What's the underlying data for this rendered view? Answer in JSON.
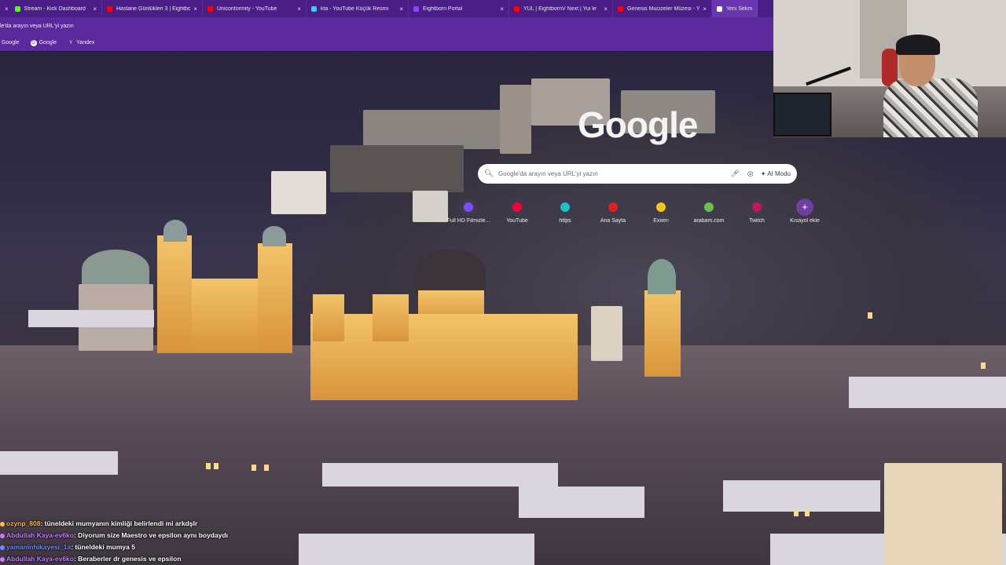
{
  "browser": {
    "tabs": [
      {
        "title": "Stream - Kick Dashboard",
        "favicon": "kick-icon",
        "favicon_color": "#53fc18",
        "active": false
      },
      {
        "title": "Hastane Günlükleri 3 | Eightbo",
        "favicon": "youtube-icon",
        "favicon_color": "#ff0000",
        "active": false
      },
      {
        "title": "Uniconformity - YouTube",
        "favicon": "youtube-icon",
        "favicon_color": "#ff0000",
        "active": false
      },
      {
        "title": "kta - YouTube Küçük Resmi",
        "favicon": "thumbnail-icon",
        "favicon_color": "#4fc3f7",
        "active": false
      },
      {
        "title": "Eightborn Portal",
        "favicon": "eightborn-icon",
        "favicon_color": "#8e44ff",
        "active": false
      },
      {
        "title": "YUL | EightbornV Next | Yui le",
        "favicon": "youtube-icon",
        "favicon_color": "#ff0000",
        "active": false
      },
      {
        "title": "Genesis Mucizeler Müzesi - Yo",
        "favicon": "youtube-icon",
        "favicon_color": "#ff0000",
        "active": false
      },
      {
        "title": "Yeni Sekme",
        "favicon": "chrome-icon",
        "favicon_color": "#ffffff",
        "active": true
      }
    ],
    "address_text": "le'da arayın veya URL'yi yazın",
    "bookmarks": [
      {
        "label": "Google",
        "icon": "google-icon"
      },
      {
        "label": "Google",
        "icon": "google-icon"
      },
      {
        "label": "Yandex",
        "icon": "yandex-icon"
      }
    ],
    "theme_color": "#5a2a9c"
  },
  "newtab": {
    "logo": "Google",
    "search_placeholder": "Google'da arayın veya URL'yi yazın",
    "ai_mode_label": "AI Modu",
    "shortcuts": [
      {
        "label": "Full HD Filmizle...",
        "icon": "film-icon",
        "color": "#7c4dff"
      },
      {
        "label": "YouTube",
        "icon": "youtube-icon",
        "color": "#ff0033"
      },
      {
        "label": "https",
        "icon": "link-icon",
        "color": "#18c4c9"
      },
      {
        "label": "Ana Sayfa",
        "icon": "home-icon",
        "color": "#e02020"
      },
      {
        "label": "Exxen",
        "icon": "exxen-icon",
        "color": "#f5c518"
      },
      {
        "label": "arabam.com",
        "icon": "arabam-icon",
        "color": "#6abf4b"
      },
      {
        "label": "Twitch",
        "icon": "twitch-icon",
        "color": "#c2185b"
      },
      {
        "label": "Kısayol ekle",
        "icon": "plus-icon",
        "color": "#9c27b0"
      }
    ]
  },
  "chat": {
    "messages": [
      {
        "user": "ozynp_808",
        "text": ": tüneldeki mumyanın kimliği belirlendi mi arkdşlr",
        "user_color": "#ffb84d"
      },
      {
        "user": "Abdullah Kaya-ev6ko",
        "text": ": Diyorum size Maestro ve epsilon aynı boydaydı",
        "user_color": "#c77dff"
      },
      {
        "user": "yamaninhikayesi_1a",
        "text": ": tüneldeki mumya 5",
        "user_color": "#6e8bff"
      },
      {
        "user": "Abdullah Kaya-ev6ko",
        "text": ": Beraberler dr genesis ve epsilon",
        "user_color": "#c77dff"
      }
    ]
  }
}
